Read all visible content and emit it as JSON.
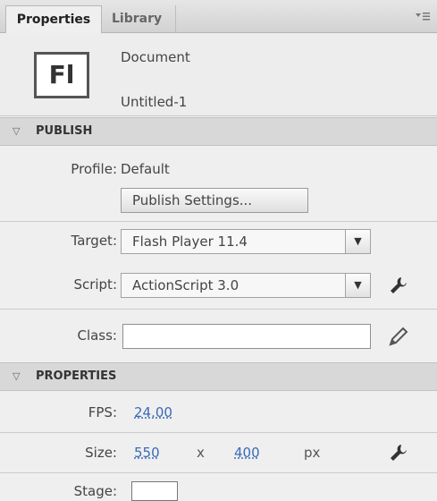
{
  "tabs": {
    "properties": "Properties",
    "library": "Library"
  },
  "document": {
    "icon_text": "Fl",
    "type_label": "Document",
    "name": "Untitled-1"
  },
  "publish": {
    "header": "PUBLISH",
    "profile_label": "Profile:",
    "profile_value": "Default",
    "settings_button": "Publish Settings...",
    "target_label": "Target:",
    "target_value": "Flash Player 11.4",
    "script_label": "Script:",
    "script_value": "ActionScript 3.0",
    "class_label": "Class:",
    "class_value": ""
  },
  "properties": {
    "header": "PROPERTIES",
    "fps_label": "FPS:",
    "fps_value": "24.00",
    "size_label": "Size:",
    "width": "550",
    "times": "x",
    "height": "400",
    "unit": "px",
    "stage_label": "Stage:",
    "stage_color": "#ffffff"
  },
  "icons": {
    "menu": "panel-menu-icon",
    "collapse": "triangle-down-icon",
    "settings": "wrench-icon",
    "edit": "pencil-icon"
  }
}
